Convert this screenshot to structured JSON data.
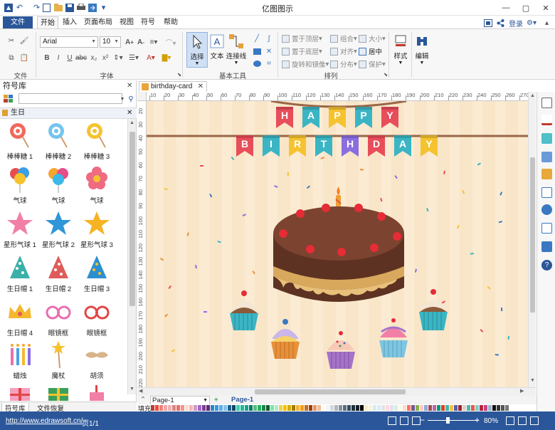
{
  "app": {
    "title": "亿图图示",
    "file_tab": "文件",
    "tabs": [
      "开始",
      "插入",
      "页面布局",
      "视图",
      "符号",
      "帮助"
    ],
    "login": "登录"
  },
  "ribbon": {
    "groups": [
      "文件",
      "字体",
      "基本工具",
      "排列"
    ],
    "font_name": "Arial",
    "font_size": "10",
    "tools": [
      "选择",
      "文本",
      "连接线"
    ],
    "arrange": [
      "置于顶层",
      "组合",
      "大小",
      "置于底层",
      "对齐",
      "居中",
      "旋转和镜像",
      "分布",
      "保护"
    ],
    "style_label": "样式",
    "edit_label": "编辑"
  },
  "library": {
    "title": "符号库",
    "category": "生日",
    "symbols": [
      "棒棒糖 1",
      "棒棒糖 2",
      "棒棒糖 3",
      "气球",
      "气球",
      "气球",
      "星形气球 1",
      "星形气球 2",
      "星形气球 3",
      "生日帽 1",
      "生日帽 2",
      "生日帽 3",
      "生日帽 4",
      "眼镜框",
      "眼镜框",
      "蜡烛",
      "魔杖",
      "胡须"
    ],
    "bottom_tabs": [
      "符号库",
      "文件恢复"
    ]
  },
  "document": {
    "tab_name": "birthday-card",
    "ruler_h": [
      "10",
      "20",
      "30",
      "40",
      "50",
      "60",
      "70",
      "80",
      "90",
      "100",
      "110",
      "120",
      "130",
      "140",
      "150",
      "160",
      "170",
      "180",
      "190",
      "200",
      "210",
      "220",
      "230",
      "240",
      "250",
      "260",
      "270"
    ],
    "ruler_v": [
      "20",
      "30",
      "40",
      "50",
      "60",
      "70",
      "80",
      "90",
      "100",
      "110",
      "120",
      "130",
      "140",
      "150",
      "160",
      "170",
      "180",
      "190",
      "200",
      "210",
      "220"
    ],
    "banner_top": [
      "H",
      "A",
      "P",
      "P",
      "Y"
    ],
    "banner_bottom": [
      "B",
      "I",
      "R",
      "T",
      "H",
      "D",
      "A",
      "Y"
    ]
  },
  "pages": {
    "page_selector": "Page-1",
    "active_page": "Page-1",
    "fill_label": "填充"
  },
  "status": {
    "url": "http://www.edrawsoft.cn/",
    "page_info": "页1/1",
    "zoom": "80%"
  },
  "colors": {
    "accent": "#2b579a",
    "canvas_bg": "#f9e6c9",
    "cake": "#6b3a26"
  }
}
